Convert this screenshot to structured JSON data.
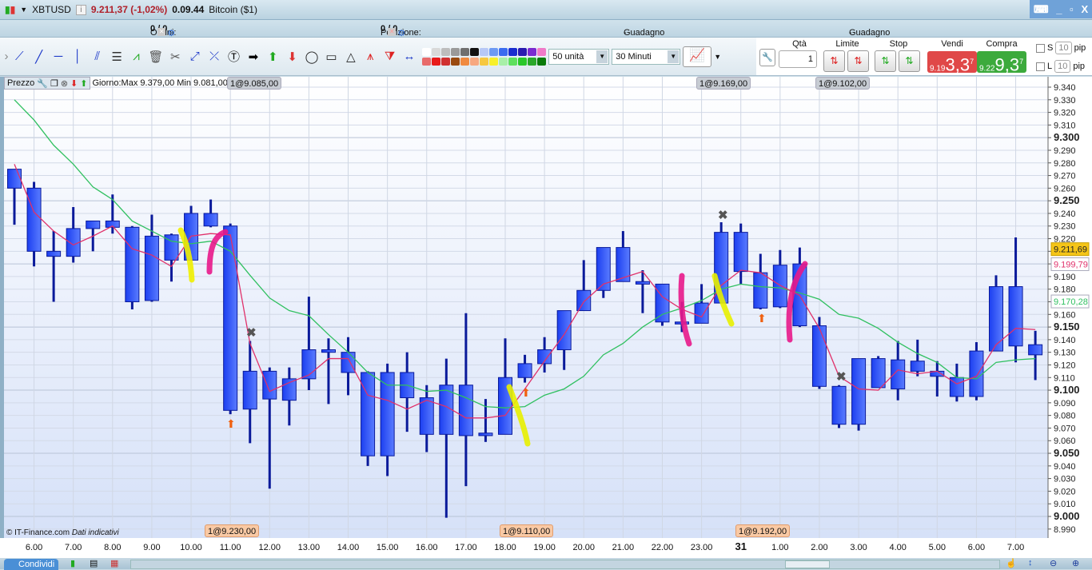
{
  "header": {
    "symbol": "XBTUSD",
    "price_change": "9.211,37 (-1,02%)",
    "time": "0.09.44",
    "instrument": "Bitcoin ($1)"
  },
  "status": {
    "orders_label": "Ordini:",
    "orders_value": "0",
    "orders_total": "/ 0",
    "position_label": "Posizione:",
    "position_value": "0",
    "position_total": "/ 0",
    "latent_label": "Guadagno latente:",
    "latent_value": "-",
    "day_label": "Guadagno Giorno:",
    "day_value": "-"
  },
  "toolbar": {
    "units": "50 unità",
    "timeframe": "30 Minuti",
    "swatches": [
      "#ffffff",
      "#d9d9d9",
      "#bdbdbd",
      "#9a9a9a",
      "#6f6f6f",
      "#111111",
      "#b7c8f6",
      "#6d9af4",
      "#3b6cf0",
      "#1a2dcf",
      "#2a1ab0",
      "#7b2ad0",
      "#f07ac8",
      "#e86a6a",
      "#e81a1a",
      "#d03030",
      "#9a4a10",
      "#f08a40",
      "#f7a880",
      "#f7c840",
      "#f7f02a",
      "#a8f0a8",
      "#5ee05e",
      "#2ac82a",
      "#2aa82a",
      "#0a7a0a"
    ]
  },
  "trade": {
    "qty_label": "Qtà",
    "qty_value": "1",
    "limit_label": "Limite",
    "stop_label": "Stop",
    "sell_label": "Vendi",
    "buy_label": "Compra",
    "sell_prefix": "9.19",
    "sell_big": "3,3",
    "sell_sup": "7",
    "buy_prefix": "9.22",
    "buy_big": "9,3",
    "buy_sup": "7",
    "s_label": "S",
    "l_label": "L",
    "s_pip": "10",
    "l_pip": "10",
    "pip_label": "pip"
  },
  "pane": {
    "name": "Prezzo",
    "daily": "Giorno:Max 9.379,00 Min 9.081,00"
  },
  "tags": {
    "top": [
      "1@9.085,00",
      "1@9.169,00",
      "1@9.102,00"
    ],
    "bottom": [
      "1@9.230,00",
      "1@9.110,00",
      "1@9.192,00"
    ]
  },
  "footer": {
    "copyright": "© IT-Finance.com",
    "note": "Dati indicativi",
    "share": "Condividi"
  },
  "chart_data": {
    "type": "candlestick",
    "ylim": [
      8985,
      9345
    ],
    "y_ticks": [
      "9.340",
      "9.330",
      "9.320",
      "9.310",
      "9.300",
      "9.290",
      "9.280",
      "9.270",
      "9.260",
      "9.250",
      "9.240",
      "9.230",
      "9.220",
      "9.190",
      "9.180",
      "9.160",
      "9.150",
      "9.140",
      "9.130",
      "9.120",
      "9.110",
      "9.100",
      "9.090",
      "9.080",
      "9.070",
      "9.060",
      "9.050",
      "9.040",
      "9.030",
      "9.020",
      "9.010",
      "9.000",
      "8.990"
    ],
    "x_labels": [
      "6.00",
      "7.00",
      "8.00",
      "9.00",
      "10.00",
      "11.00",
      "12.00",
      "13.00",
      "14.00",
      "15.00",
      "16.00",
      "17.00",
      "18.00",
      "19.00",
      "20.00",
      "21.00",
      "22.00",
      "23.00",
      "31",
      "1.00",
      "2.00",
      "3.00",
      "4.00",
      "5.00",
      "6.00",
      "7.00"
    ],
    "candles": [
      [
        9275,
        9275,
        9231,
        9260
      ],
      [
        9260,
        9265,
        9198,
        9210
      ],
      [
        9210,
        9226,
        9170,
        9206
      ],
      [
        9206,
        9245,
        9201,
        9228
      ],
      [
        9228,
        9234,
        9210,
        9234
      ],
      [
        9234,
        9255,
        9224,
        9229
      ],
      [
        9229,
        9230,
        9164,
        9170
      ],
      [
        9171,
        9239,
        9170,
        9222
      ],
      [
        9203,
        9224,
        9186,
        9223
      ],
      [
        9203,
        9246,
        9203,
        9240
      ],
      [
        9240,
        9251,
        9229,
        9230
      ],
      [
        9230,
        9232,
        9081,
        9084
      ],
      [
        9085,
        9139,
        9058,
        9115
      ],
      [
        9115,
        9118,
        9022,
        9093
      ],
      [
        9092,
        9118,
        9072,
        9109
      ],
      [
        9109,
        9174,
        9100,
        9132
      ],
      [
        9132,
        9141,
        9089,
        9130
      ],
      [
        9130,
        9142,
        9096,
        9114
      ],
      [
        9114,
        9115,
        9040,
        9048
      ],
      [
        9048,
        9121,
        9032,
        9114
      ],
      [
        9114,
        9130,
        9067,
        9094
      ],
      [
        9094,
        9104,
        9051,
        9065
      ],
      [
        9065,
        9125,
        8999,
        9104
      ],
      [
        9104,
        9161,
        9024,
        9064
      ],
      [
        9064,
        9093,
        9059,
        9066
      ],
      [
        9065,
        9141,
        9065,
        9110
      ],
      [
        9110,
        9128,
        9106,
        9121
      ],
      [
        9121,
        9142,
        9114,
        9132
      ],
      [
        9132,
        9163,
        9116,
        9163
      ],
      [
        9163,
        9203,
        9163,
        9179
      ],
      [
        9179,
        9213,
        9173,
        9213
      ],
      [
        9213,
        9226,
        9186,
        9186
      ],
      [
        9186,
        9195,
        9161,
        9184
      ],
      [
        9184,
        9184,
        9151,
        9154
      ],
      [
        9154,
        9170,
        9146,
        9153
      ],
      [
        9153,
        9184,
        9153,
        9169
      ],
      [
        9169,
        9233,
        9169,
        9225
      ],
      [
        9225,
        9232,
        9184,
        9194
      ],
      [
        9193,
        9208,
        9164,
        9165
      ],
      [
        9166,
        9211,
        9165,
        9199
      ],
      [
        9200,
        9213,
        9150,
        9151
      ],
      [
        9151,
        9158,
        9101,
        9103
      ],
      [
        9103,
        9104,
        9070,
        9073
      ],
      [
        9073,
        9125,
        9068,
        9125
      ],
      [
        9125,
        9127,
        9102,
        9102
      ],
      [
        9101,
        9139,
        9092,
        9124
      ],
      [
        9123,
        9140,
        9111,
        9115
      ],
      [
        9115,
        9123,
        9095,
        9111
      ],
      [
        9110,
        9121,
        9091,
        9095
      ],
      [
        9095,
        9138,
        9092,
        9131
      ],
      [
        9131,
        9191,
        9131,
        9182
      ],
      [
        9182,
        9221,
        9122,
        9135
      ],
      [
        9136,
        9147,
        9108,
        9128
      ]
    ],
    "candle_fields": [
      "open",
      "high",
      "low",
      "close"
    ],
    "ma_fast": [
      9279,
      9241,
      9226,
      9215,
      9222,
      9230,
      9212,
      9207,
      9198,
      9222,
      9224,
      9223,
      9137,
      9099,
      9106,
      9112,
      9125,
      9125,
      9096,
      9092,
      9085,
      9092,
      9087,
      9078,
      9078,
      9080,
      9101,
      9123,
      9144,
      9170,
      9184,
      9189,
      9194,
      9174,
      9164,
      9158,
      9183,
      9195,
      9193,
      9183,
      9175,
      9149,
      9111,
      9101,
      9100,
      9116,
      9113,
      9115,
      9105,
      9111,
      9136,
      9149,
      9148
    ],
    "ma_slow": [
      9330,
      9314,
      9294,
      9279,
      9261,
      9251,
      9234,
      9226,
      9218,
      9216,
      9218,
      9210,
      9191,
      9173,
      9163,
      9159,
      9144,
      9130,
      9114,
      9104,
      9104,
      9099,
      9100,
      9094,
      9087,
      9086,
      9087,
      9096,
      9101,
      9111,
      9128,
      9137,
      9150,
      9160,
      9165,
      9171,
      9180,
      9184,
      9182,
      9181,
      9177,
      9172,
      9160,
      9157,
      9149,
      9138,
      9129,
      9122,
      9110,
      9109,
      9122,
      9124,
      9125
    ],
    "price_labels": {
      "last": "9.211,69",
      "ma_fast": "9.199,79",
      "ma_slow": "9.170,28"
    },
    "colors": {
      "candle": "#2450f0",
      "wick": "#0a1a9a",
      "ma_fast": "#e0306a",
      "ma_slow": "#30c060",
      "last": "#f5c518"
    },
    "grid": true
  }
}
